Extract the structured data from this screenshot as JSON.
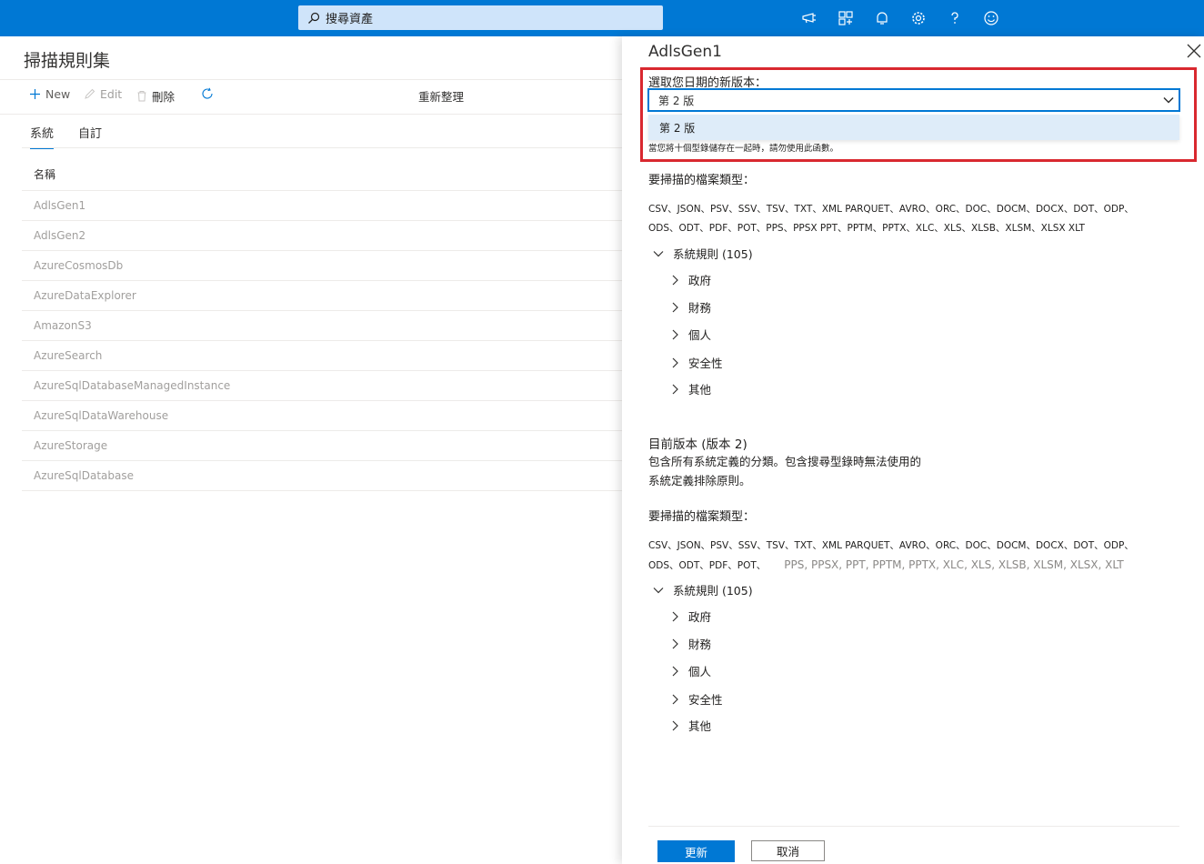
{
  "topbar": {
    "search_placeholder": "搜尋資產",
    "icons": [
      "feedback-icon",
      "directory-icon",
      "bell-icon",
      "gear-icon",
      "help-icon",
      "smiley-icon"
    ]
  },
  "page": {
    "title": "掃描規則集",
    "commands": {
      "new": "New",
      "edit": "Edit",
      "delete": "刪除",
      "refresh": "重新整理"
    },
    "tabs": [
      "系統",
      "自訂"
    ],
    "list_header": "名稱",
    "rows": [
      "AdlsGen1",
      "AdlsGen2",
      "AzureCosmosDb",
      "AzureDataExplorer",
      "AmazonS3",
      "AzureSearch",
      "AzureSqlDatabaseManagedInstance",
      "AzureSqlDataWarehouse",
      "AzureStorage",
      "AzureSqlDatabase"
    ]
  },
  "panel": {
    "title": "AdlsGen1",
    "select_label": "選取您日期的新版本：",
    "select_value": "第 2 版",
    "dropdown_option": "第 2 版",
    "hint": "當您將十個型錄儲存在一起時，請勿使用此函數。",
    "file_types_label": "要掃描的檔案類型：",
    "file_types_line1": "CSV、JSON、PSV、SSV、TSV、TXT、XML PARQUET、AVRO、ORC、DOC、DOCM、DOCX、DOT、ODP、",
    "file_types_line2": "ODS、ODT、PDF、POT、PPS、PPSX PPT、PPTM、PPTX、XLC、XLS、XLSB、XLSM、XLSX XLT",
    "rules_root": "系統規則 (105)",
    "rules": [
      "政府",
      "財務",
      "個人",
      "安全性",
      "其他"
    ],
    "current_version_title": "目前版本 (版本 2)",
    "current_version_desc": "包含所有系統定義的分類。包含搜尋型錄時無法使用的系統定義排除原則。",
    "file_types_label2": "要掃描的檔案類型：",
    "file_types2_line1": "CSV、JSON、PSV、SSV、TSV、TXT、XML PARQUET、AVRO、ORC、DOC、DOCM、DOCX、DOT、ODP、",
    "file_types2_line2a": "ODS、ODT、PDF、POT、",
    "file_types2_line2b": "PPS, PPSX, PPT, PPTM, PPTX, XLC, XLS, XLSB, XLSM, XLSX, XLT",
    "rules_root2": "系統規則 (105)",
    "rules2": [
      "政府",
      "財務",
      "個人",
      "安全性",
      "其他"
    ],
    "update_button": "更新",
    "cancel_button": "取消"
  },
  "colors": {
    "accent": "#0078d4",
    "highlight_border": "#d9282f",
    "dropdown_bg": "#deecf9"
  }
}
